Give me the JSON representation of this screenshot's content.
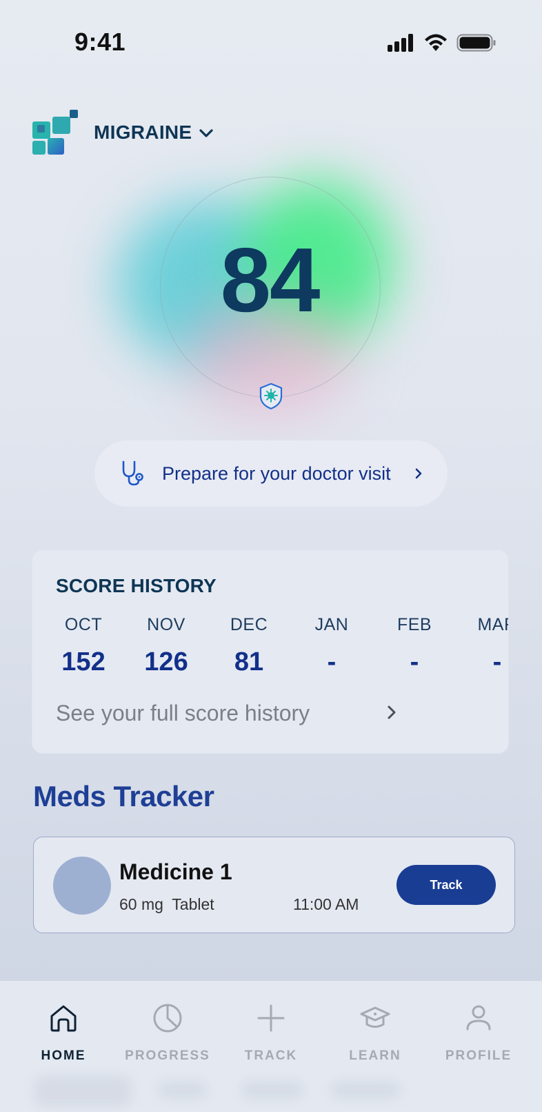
{
  "status_bar": {
    "time": "9:41",
    "icons": [
      "signal-icon",
      "wifi-icon",
      "battery-icon"
    ]
  },
  "header": {
    "condition": "MIGRAINE",
    "logo_icon": "app-logo-icon",
    "dropdown_icon": "chevron-down-icon"
  },
  "score": {
    "value": "84",
    "badge_icon": "shield-icon",
    "colors": {
      "teal": "#46c8d2",
      "green": "#3ceb82",
      "pink": "#e8afc8",
      "score_text": "#0d3a5e"
    }
  },
  "doctor_visit": {
    "label": "Prepare for your doctor visit",
    "icon": "stethoscope-icon",
    "arrow_icon": "chevron-right-icon"
  },
  "score_history": {
    "title": "SCORE HISTORY",
    "months": [
      {
        "month": "OCT",
        "value": "152"
      },
      {
        "month": "NOV",
        "value": "126"
      },
      {
        "month": "DEC",
        "value": "81"
      },
      {
        "month": "JAN",
        "value": "-"
      },
      {
        "month": "FEB",
        "value": "-"
      },
      {
        "month": "MAR",
        "value": "-"
      }
    ],
    "link_label": "See your full score history",
    "link_icon": "chevron-right-icon"
  },
  "meds_tracker": {
    "title": "Meds Tracker",
    "medicine": {
      "name": "Medicine 1",
      "dose": "60 mg  Tablet",
      "time": "11:00 AM",
      "action": "Track"
    },
    "colors": {
      "button": "#1a3d94",
      "avatar": "#9eb0d2"
    }
  },
  "bottom_nav": {
    "active": "HOME",
    "items": [
      {
        "label": "HOME",
        "icon": "home-icon"
      },
      {
        "label": "PROGRESS",
        "icon": "pie-chart-icon"
      },
      {
        "label": "TRACK",
        "icon": "plus-icon"
      },
      {
        "label": "LEARN",
        "icon": "graduation-cap-icon"
      },
      {
        "label": "PROFILE",
        "icon": "user-icon"
      }
    ]
  }
}
